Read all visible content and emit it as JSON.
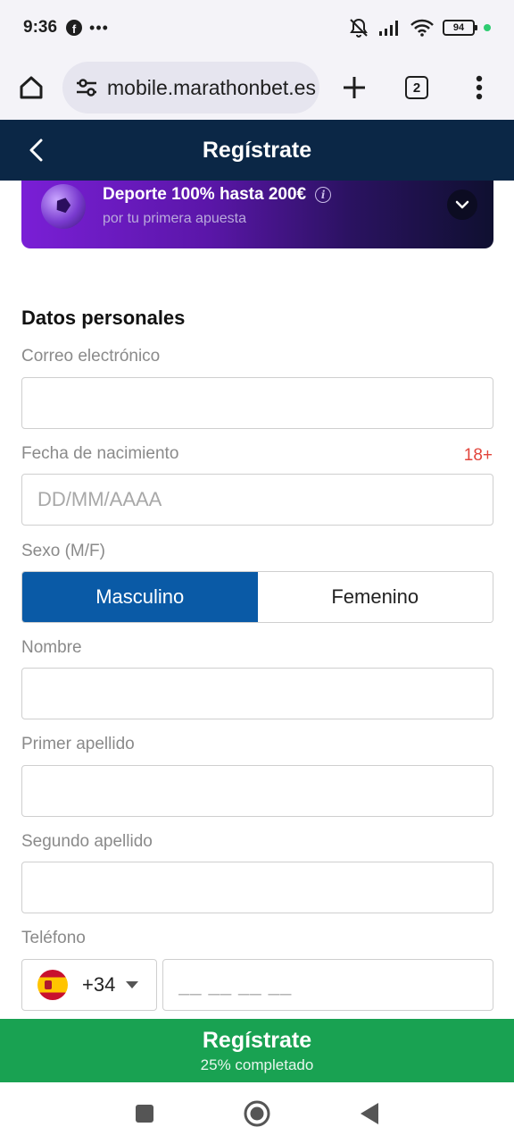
{
  "status_bar": {
    "time": "9:36",
    "notification_icons": [
      "facebook-icon",
      "more-dots-icon"
    ],
    "battery": "94",
    "system_icons": [
      "mute-icon",
      "signal-icon",
      "wifi-icon",
      "battery-icon"
    ]
  },
  "browser": {
    "url": "mobile.marathonbet.es",
    "tab_count": "2"
  },
  "header": {
    "title": "Regístrate",
    "colors": {
      "background": "#0b2746"
    }
  },
  "promo": {
    "title": "Deporte 100% hasta 200€",
    "subtitle": "por tu primera apuesta",
    "info_glyph": "i"
  },
  "form": {
    "section_title": "Datos personales",
    "email": {
      "label": "Correo electrónico",
      "value": "",
      "placeholder": ""
    },
    "birthdate": {
      "label": "Fecha de nacimiento",
      "badge": "18+",
      "value": "",
      "placeholder": "DD/MM/AAAA"
    },
    "gender": {
      "label": "Sexo (M/F)",
      "options": [
        "Masculino",
        "Femenino"
      ],
      "selected": "Masculino"
    },
    "first_name": {
      "label": "Nombre",
      "value": "",
      "placeholder": ""
    },
    "surname1": {
      "label": "Primer apellido",
      "value": "",
      "placeholder": ""
    },
    "surname2": {
      "label": "Segundo apellido",
      "value": "",
      "placeholder": ""
    },
    "phone": {
      "label": "Teléfono",
      "country_code": "+34",
      "country_flag": "spain-flag-icon",
      "value": "",
      "placeholder": "__ __ __ __"
    }
  },
  "submit": {
    "label": "Regístrate",
    "progress_text": "25% completado",
    "progress": 0.25,
    "colors": {
      "background": "#19a252"
    }
  },
  "nav": {
    "buttons": [
      "recents-button",
      "home-button",
      "back-button"
    ]
  }
}
